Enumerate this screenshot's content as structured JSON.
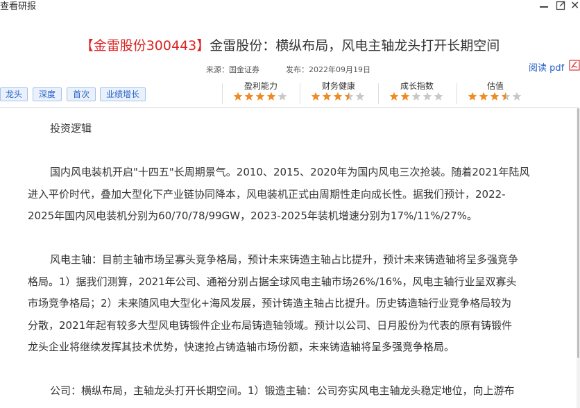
{
  "window": {
    "title": "查看研报"
  },
  "report": {
    "title_code": "【金雷股份300443】",
    "title_text": "金雷股份：横纵布局，风电主轴龙头打开长期空间",
    "source": "来源：国金证券",
    "publish_date": "发布：2022年09月19日",
    "read_pdf_label": "阅读 pdf"
  },
  "tags": [
    "龙头",
    "深度",
    "首次",
    "业绩增长"
  ],
  "ratings": [
    {
      "label": "盈利能力",
      "stars": 4
    },
    {
      "label": "财务健康",
      "stars": 3.5
    },
    {
      "label": "成长指数",
      "stars": 2
    },
    {
      "label": "估值",
      "stars": 3.5
    }
  ],
  "colors": {
    "star_filled": "#f08a24",
    "star_empty": "#c8c8c8",
    "title_highlight": "#dd2222",
    "link": "#2a62c9"
  },
  "icons": {
    "minimize": "minimize-icon",
    "maximize": "maximize-icon",
    "close": "close-icon",
    "pdf": "pdf-icon",
    "star": "star-icon"
  },
  "content": {
    "heading": "投资逻辑",
    "paragraphs": [
      [
        "国内风电装机开启\"十四五\"长周期景气。2010、2015、2020年为国内风电三次抢装。随着2021年陆风",
        "进入平价时代，叠加大型化下产业链协同降本，风电装机正式由周期性走向成长性。据我们预计，2022-",
        "2025年国内风电装机分别为60/70/78/99GW，2023-2025年装机增速分别为17%/11%/27%。"
      ],
      [
        "风电主轴：目前主轴市场呈寡头竞争格局，预计未来铸造主轴占比提升，预计未来铸造轴将呈多强竞争",
        "格局。1）据我们测算，2021年公司、通裕分别占据全球风电主轴市场26%/16%，风电主轴行业呈双寡头",
        "市场竞争格局；2）未来随风电大型化+海风发展，预计铸造主轴占比提升。历史铸造轴行业竞争格局较为",
        "分散，2021年起有较多大型风电铸锻件企业布局铸造轴领域。预计以公司、日月股份为代表的原有铸锻件",
        "龙头企业将继续发挥其技术优势，快速抢占铸造轴市场份额，未来铸造轴将呈多强竞争格局。"
      ],
      [
        "公司：横纵布局，主轴龙头打开长期空间。1）锻造主轴：公司夯实风电主轴龙头稳定地位，向上游布"
      ]
    ]
  }
}
